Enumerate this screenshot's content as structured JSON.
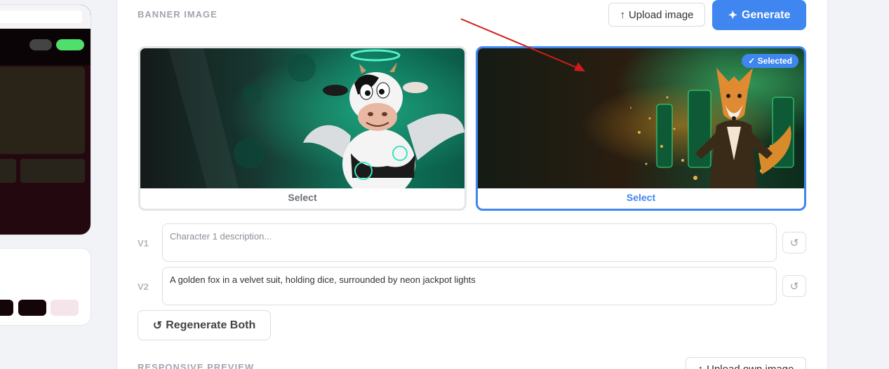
{
  "banner_section": {
    "title": "BANNER IMAGE",
    "upload_label": "Upload image",
    "upload_icon": "↑",
    "generate_label": "Generate",
    "generate_icon": "✦"
  },
  "variants": [
    {
      "id": "V1",
      "select_label": "Select",
      "selected": false,
      "image": "cow-angel-illustration",
      "description": "",
      "placeholder": "Character 1 description..."
    },
    {
      "id": "V2",
      "select_label": "Select",
      "selected": true,
      "selected_badge": "✓ Selected",
      "image": "golden-fox-illustration",
      "description": "A golden fox in a velvet suit, holding dice, surrounded by neon jackpot lights",
      "placeholder": ""
    }
  ],
  "reset_icon": "↺",
  "regenerate": {
    "icon": "↺",
    "label": "Regenerate Both"
  },
  "responsive_section": {
    "title": "RESPONSIVE PREVIEW",
    "upload_own_label": "Upload own image",
    "upload_icon": "↑"
  },
  "colors": {
    "accent": "#3f86f0",
    "annotation_arrow": "#d01c1c",
    "preview_bg": "#23090f",
    "preview_green_pill": "#4ee06a",
    "swatch_dark": "#140508",
    "swatch_light": "#f5e4ea"
  }
}
